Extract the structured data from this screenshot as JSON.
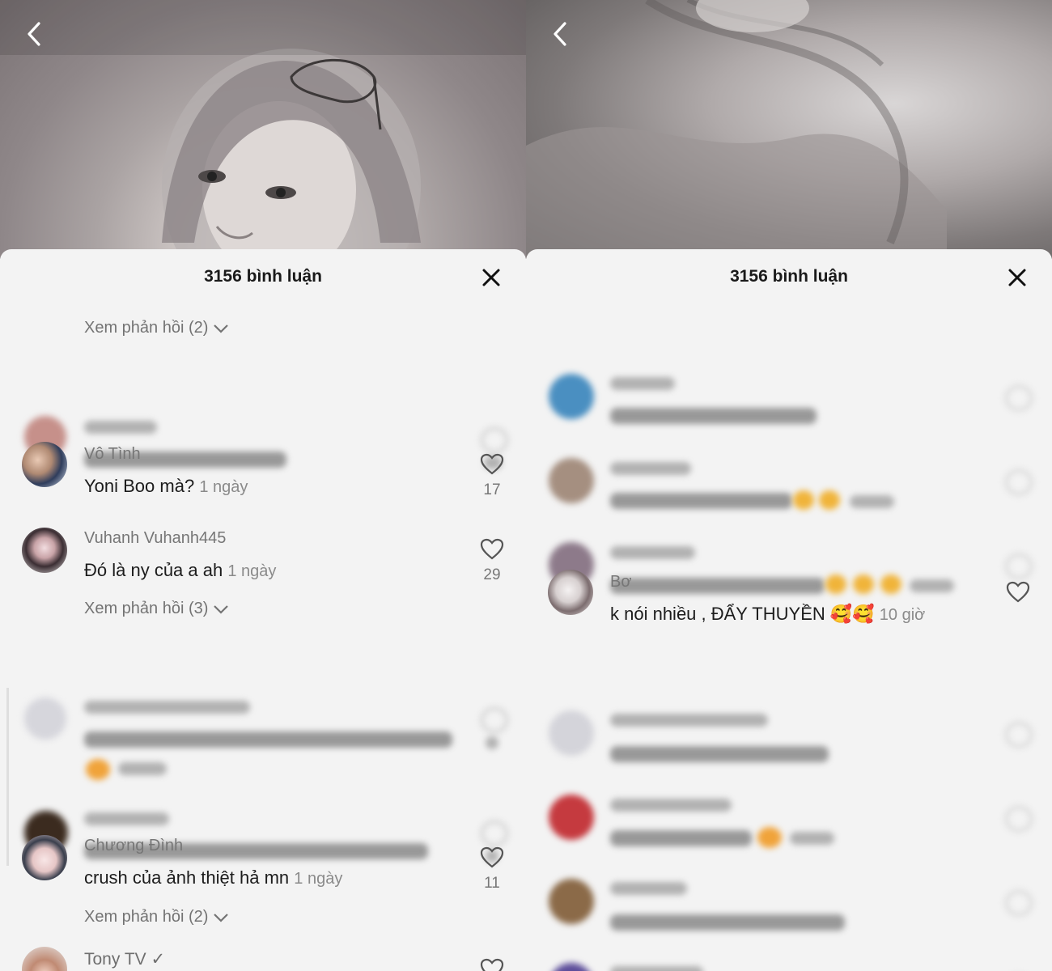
{
  "left": {
    "comment_count_label": "3156 bình luận",
    "top_replies_label": "Xem phản hồi (2)",
    "comments": [
      {
        "user": "Vô Tình",
        "text": "Yoni Boo mà?",
        "time": "1 ngày",
        "likes": "17"
      },
      {
        "user": "Vuhanh Vuhanh445",
        "text": "Đó là ny của a ah",
        "time": "1 ngày",
        "likes": "29",
        "replies": "Xem phản hồi (3)"
      },
      {
        "user": "Chương Đình",
        "text": "crush của ảnh thiệt hả mn",
        "time": "1 ngày",
        "likes": "11",
        "replies": "Xem phản hồi (2)"
      },
      {
        "user": "Tony TV ✓"
      }
    ]
  },
  "right": {
    "comment_count_label": "3156 bình luận",
    "comments": [
      {
        "user": "Bơ",
        "text": "k nói nhiều , ĐẨY THUYỀN 🥰🥰",
        "time": "10 giờ"
      }
    ]
  },
  "icons": {
    "back": "chevron-left-icon",
    "close": "close-icon",
    "like": "heart-outline-icon",
    "expand": "chevron-down-icon"
  }
}
